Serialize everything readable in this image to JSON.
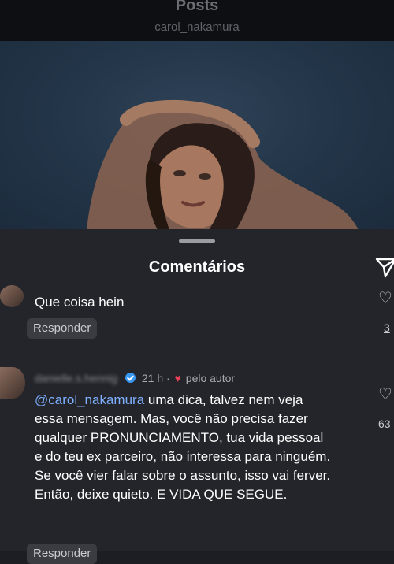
{
  "header": {
    "title": "Posts",
    "subtitle": "carol_nakamura"
  },
  "sheet": {
    "title": "Comentários"
  },
  "comments": [
    {
      "text": "Que coisa hein",
      "reply_label": "Responder",
      "like_count": "3"
    },
    {
      "username": "danielle.s.hennig",
      "verified": true,
      "time": "21 h",
      "liked_by_author_label": "pelo autor",
      "mention": "@carol_nakamura",
      "text": " uma dica, talvez nem veja essa mensagem. Mas, você não precisa fazer qualquer PRONUNCIAMENTO, tua vida pessoal e do teu ex parceiro, não interessa para ninguém. Se você vier falar sobre o assunto, isso vai ferver. Então, deixe quieto. E VIDA QUE SEGUE.",
      "reply_label": "Responder",
      "like_count": "63"
    }
  ],
  "colors": {
    "background": "#23252b",
    "header": "#0e0f12",
    "mention": "#7fb0ff",
    "verified": "#3897f0",
    "author_heart": "#ed3f55"
  },
  "icons": [
    "send-icon",
    "heart-outline-icon",
    "verified-badge-icon",
    "red-heart-icon"
  ]
}
